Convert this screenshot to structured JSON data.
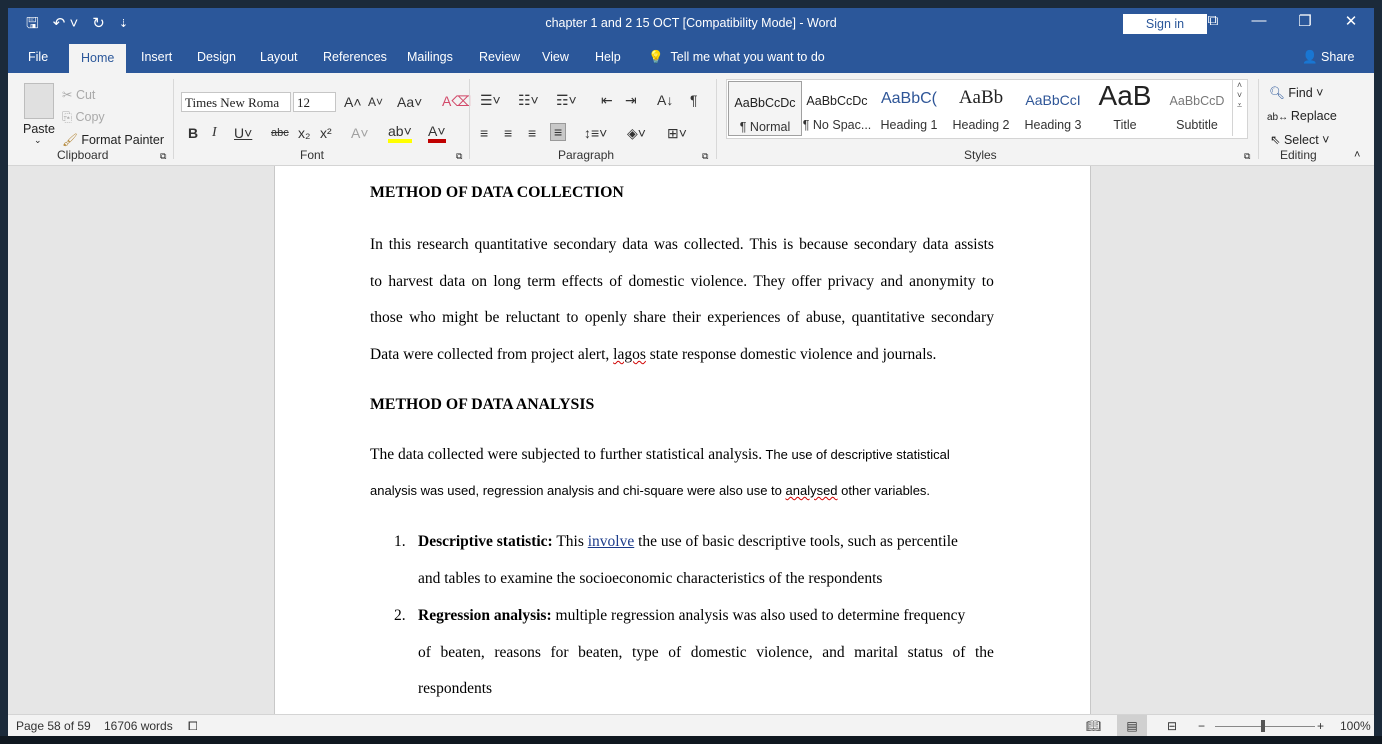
{
  "window": {
    "title": "chapter 1 and 2 15 OCT [Compatibility Mode]  -  Word",
    "sign_in": "Sign in"
  },
  "tabs": [
    "File",
    "Home",
    "Insert",
    "Design",
    "Layout",
    "References",
    "Mailings",
    "Review",
    "View",
    "Help"
  ],
  "tell_me": "Tell me what you want to do",
  "share": "Share",
  "clipboard": {
    "paste": "Paste",
    "cut": "Cut",
    "copy": "Copy",
    "format_painter": "Format Painter",
    "label": "Clipboard"
  },
  "font": {
    "name": "Times New Roma",
    "size": "12",
    "label": "Font"
  },
  "paragraph": {
    "label": "Paragraph"
  },
  "styles": {
    "label": "Styles",
    "items": [
      {
        "preview": "AaBbCcDc",
        "name": "¶ Normal"
      },
      {
        "preview": "AaBbCcDc",
        "name": "¶ No Spac..."
      },
      {
        "preview": "AaBbC(",
        "name": "Heading 1"
      },
      {
        "preview": "AaBb",
        "name": "Heading 2"
      },
      {
        "preview": "AaBbCcI",
        "name": "Heading 3"
      },
      {
        "preview": "AaB",
        "name": "Title"
      },
      {
        "preview": "AaBbCcD",
        "name": "Subtitle"
      }
    ]
  },
  "editing": {
    "find": "Find",
    "replace": "Replace",
    "select": "Select",
    "label": "Editing"
  },
  "document": {
    "h1": "METHOD OF DATA COLLECTION",
    "p1": {
      "l1": "In this research quantitative secondary data was collected. This is because secondary data assists",
      "l2": "to harvest data on long term effects of domestic violence. They offer privacy and anonymity to",
      "l3": "those who might be reluctant to openly share their experiences of abuse, quantitative secondary",
      "l4a": "Data were collected from project alert, ",
      "l4b": "lagos",
      "l4c": " state response domestic violence and journals."
    },
    "h2": "METHOD OF DATA ANALYSIS",
    "p2": {
      "l1a": "The data collected were subjected to further statistical analysis.",
      "l1b": " The use of descriptive statistical",
      "l2a": "analysis was used, regression analysis and chi-square were also use to ",
      "l2b": "analysed",
      "l2c": " other variables."
    },
    "list": [
      {
        "num": "1.",
        "bold": "Descriptive statistic:",
        "l1a": " This ",
        "l1b": "involve",
        "l1c": " the use of basic descriptive tools, such as percentile",
        "l2": "and tables to examine the socioeconomic characteristics of the respondents"
      },
      {
        "num": "2.",
        "bold": "Regression analysis:",
        "l1": " multiple regression analysis was also used to determine frequency",
        "l2": "of beaten, reasons for beaten, type of domestic violence, and marital status of the",
        "l3": "respondents"
      }
    ]
  },
  "status": {
    "page": "Page 58 of 59",
    "words": "16706 words",
    "zoom": "100%"
  }
}
